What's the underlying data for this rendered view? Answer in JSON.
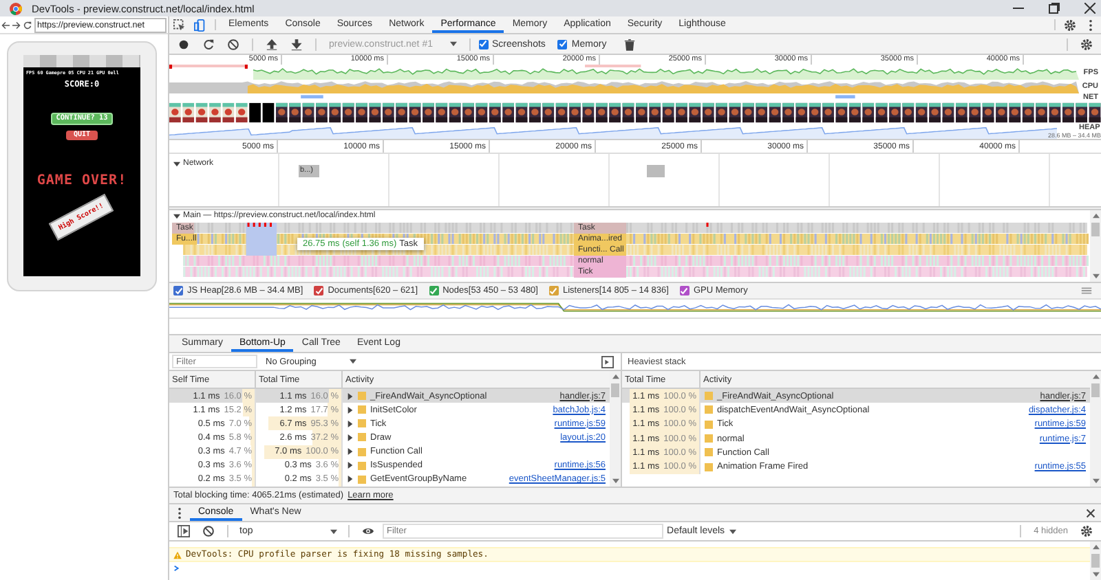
{
  "window": {
    "title": "DevTools - preview.construct.net/local/index.html"
  },
  "browser": {
    "url": "https://preview.construct.net"
  },
  "game": {
    "stats": "FPS 60 Gamepre 05 CPU 21 GPU 0ell",
    "score": "SCORE:0",
    "continue_button": "CONTINUE? 13",
    "quit_button": "QUIT",
    "game_over": "GAME OVER!",
    "badge": "High Score!!"
  },
  "devtools_tabs": [
    {
      "label": "Elements",
      "selected": false
    },
    {
      "label": "Console",
      "selected": false
    },
    {
      "label": "Sources",
      "selected": false
    },
    {
      "label": "Network",
      "selected": false
    },
    {
      "label": "Performance",
      "selected": true
    },
    {
      "label": "Memory",
      "selected": false
    },
    {
      "label": "Application",
      "selected": false
    },
    {
      "label": "Security",
      "selected": false
    },
    {
      "label": "Lighthouse",
      "selected": false
    }
  ],
  "toolbar": {
    "recording_target": "preview.construct.net #1",
    "checkboxes": [
      {
        "label": "Screenshots",
        "checked": true
      },
      {
        "label": "Memory",
        "checked": true
      }
    ]
  },
  "overview": {
    "ticks": [
      "5000 ms",
      "10000 ms",
      "15000 ms",
      "20000 ms",
      "25000 ms",
      "30000 ms",
      "35000 ms",
      "40000 ms"
    ],
    "tracks": [
      "FPS",
      "CPU",
      "NET",
      "HEAP"
    ],
    "heap_range": "28.6 MB – 34.4 MB"
  },
  "timeline": {
    "ticks": [
      "5000 ms",
      "10000 ms",
      "15000 ms",
      "20000 ms",
      "25000 ms",
      "30000 ms",
      "35000 ms",
      "40000 ms"
    ]
  },
  "network": {
    "label": "Network",
    "expanded": true,
    "requests": [
      {
        "kind": "labeled",
        "label": "b...)"
      },
      {
        "kind": "plain"
      }
    ]
  },
  "main": {
    "title": "Main — https://preview.construct.net/local/index.html",
    "expanded": true,
    "blocks": [
      {
        "label": "Task",
        "kind": "task"
      },
      {
        "label": "Fu...ll",
        "kind": "script"
      },
      {
        "label": "Task",
        "kind": "task"
      },
      {
        "label": "Anima...ired",
        "kind": "script"
      },
      {
        "label": "Functi... Call",
        "kind": "script"
      },
      {
        "label": "normal",
        "kind": "render"
      },
      {
        "label": "Tick",
        "kind": "render"
      }
    ],
    "tooltip": {
      "duration": "26.75 ms",
      "self": "(self 1.36 ms)",
      "label": "Task"
    }
  },
  "memory_counters": [
    {
      "label": "JS Heap[28.6 MB – 34.4 MB]",
      "checked": true,
      "color": "#3f6fd0"
    },
    {
      "label": "Documents[620 – 621]",
      "checked": true,
      "color": "#d04040"
    },
    {
      "label": "Nodes[53 450 – 53 480]",
      "checked": true,
      "color": "#34a853"
    },
    {
      "label": "Listeners[14 805 – 14 836]",
      "checked": true,
      "color": "#d9a33a"
    },
    {
      "label": "GPU Memory",
      "checked": true,
      "color": "#b050c8"
    }
  ],
  "details_tabs": [
    {
      "label": "Summary",
      "selected": false
    },
    {
      "label": "Bottom-Up",
      "selected": true
    },
    {
      "label": "Call Tree",
      "selected": false
    },
    {
      "label": "Event Log",
      "selected": false
    }
  ],
  "bottom_up": {
    "filter_placeholder": "Filter",
    "grouping": "No Grouping",
    "columns": [
      "Self Time",
      "Total Time",
      "Activity"
    ],
    "rows": [
      {
        "self_time": "1.1 ms",
        "self_percent": "16.0 %",
        "total_time": "1.1 ms",
        "total_percent": "16.0 %",
        "activity": "_FireAndWait_AsyncOptional",
        "source": "handler.js:7",
        "selected": true
      },
      {
        "self_time": "1.1 ms",
        "self_percent": "15.2 %",
        "total_time": "1.2 ms",
        "total_percent": "17.7 %",
        "activity": "InitSetColor",
        "source": "batchJob.js:4",
        "selected": false
      },
      {
        "self_time": "0.5 ms",
        "self_percent": "7.0 %",
        "total_time": "6.7 ms",
        "total_percent": "95.3 %",
        "activity": "Tick",
        "source": "runtime.js:59",
        "selected": false
      },
      {
        "self_time": "0.4 ms",
        "self_percent": "5.8 %",
        "total_time": "2.6 ms",
        "total_percent": "37.2 %",
        "activity": "Draw",
        "source": "layout.js:20",
        "selected": false
      },
      {
        "self_time": "0.3 ms",
        "self_percent": "4.7 %",
        "total_time": "7.0 ms",
        "total_percent": "100.0 %",
        "activity": "Function Call",
        "selected": false
      },
      {
        "self_time": "0.3 ms",
        "self_percent": "3.6 %",
        "total_time": "0.3 ms",
        "total_percent": "3.6 %",
        "activity": "IsSuspended",
        "source": "runtime.js:56",
        "selected": false
      },
      {
        "self_time": "0.2 ms",
        "self_percent": "3.5 %",
        "total_time": "0.2 ms",
        "total_percent": "3.5 %",
        "activity": "GetEventGroupByName",
        "source": "eventSheetManager.js:5",
        "selected": false
      }
    ]
  },
  "heaviest_stack": {
    "title": "Heaviest stack",
    "columns": [
      "Total Time",
      "Activity"
    ],
    "rows": [
      {
        "total_time": "1.1 ms",
        "total_percent": "100.0 %",
        "activity": "_FireAndWait_AsyncOptional",
        "source": "handler.js:7",
        "selected": true
      },
      {
        "total_time": "1.1 ms",
        "total_percent": "100.0 %",
        "activity": "dispatchEventAndWait_AsyncOptional",
        "source": "dispatcher.js:4",
        "selected": false
      },
      {
        "total_time": "1.1 ms",
        "total_percent": "100.0 %",
        "activity": "Tick",
        "source": "runtime.js:59",
        "selected": false
      },
      {
        "total_time": "1.1 ms",
        "total_percent": "100.0 %",
        "activity": "normal",
        "source": "runtime.js:7",
        "selected": false
      },
      {
        "total_time": "1.1 ms",
        "total_percent": "100.0 %",
        "activity": "Function Call",
        "selected": false
      },
      {
        "total_time": "1.1 ms",
        "total_percent": "100.0 %",
        "activity": "Animation Frame Fired",
        "source": "runtime.js:55",
        "selected": false
      }
    ]
  },
  "blocking": {
    "text": "Total blocking time: 4065.21ms (estimated)",
    "link": "Learn more"
  },
  "drawer_tabs": [
    {
      "label": "Console",
      "selected": true
    },
    {
      "label": "What's New",
      "selected": false
    }
  ],
  "console": {
    "context": "top",
    "filter_placeholder": "Filter",
    "levels": "Default levels",
    "hidden": "4 hidden",
    "messages": [
      {
        "kind": "warning",
        "text": "DevTools: CPU profile parser is fixing 18 missing samples."
      }
    ]
  }
}
